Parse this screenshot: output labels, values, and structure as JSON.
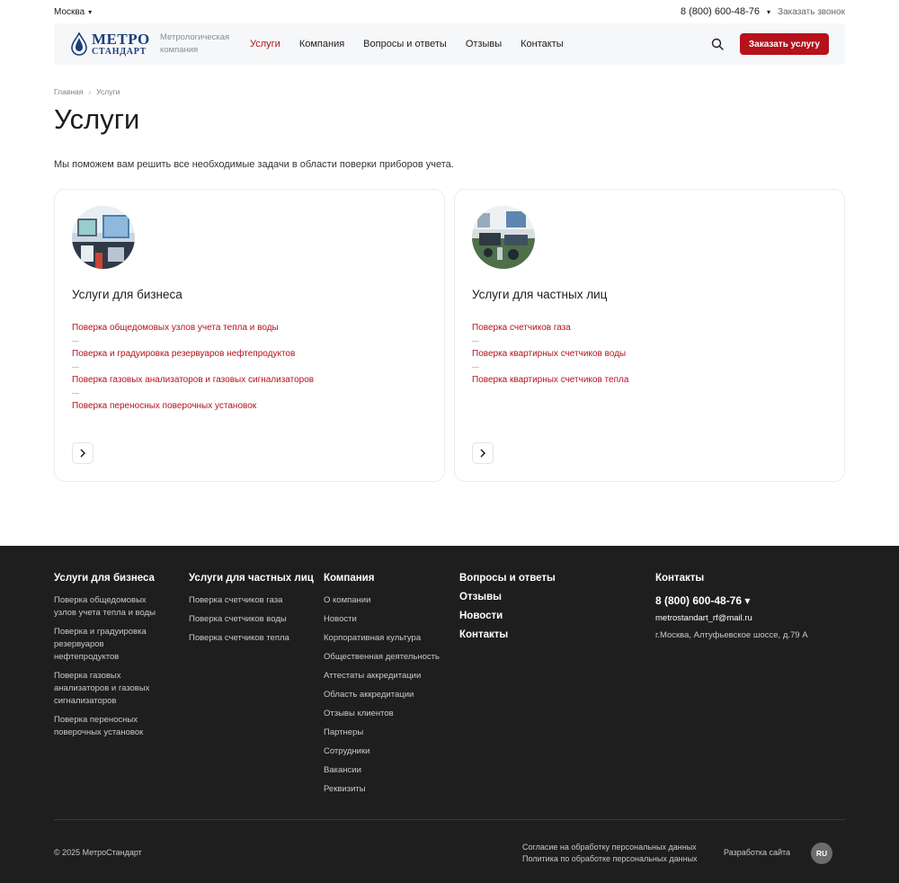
{
  "topbar": {
    "city": "Москва",
    "phone": "8 (800) 600-48-76",
    "callback": "Заказать звонок"
  },
  "header": {
    "logo_line1": "МЕТРО",
    "logo_line2": "СТАНДАРТ",
    "tagline": "Метрологическая компания",
    "nav": [
      "Услуги",
      "Компания",
      "Вопросы и ответы",
      "Отзывы",
      "Контакты"
    ],
    "active_nav": "Услуги",
    "order_label": "Заказать услугу",
    "brand_color": "#b5121b"
  },
  "breadcrumb": [
    "Главная",
    "Услуги"
  ],
  "page": {
    "title": "Услуги",
    "lead": "Мы поможем вам решить все необходимые задачи в области поверки приборов учета."
  },
  "cards": [
    {
      "title": "Услуги для бизнеса",
      "links": [
        "Поверка общедомовых узлов учета тепла и воды",
        "Поверка и градуировка резервуаров нефтепродуктов",
        "Поверка газовых анализаторов и газовых сигнализаторов",
        "Поверка переносных поверочных установок"
      ]
    },
    {
      "title": "Услуги для частных лиц",
      "links": [
        "Поверка счетчиков газа",
        "Поверка квартирных счетчиков воды",
        "Поверка квартирных счетчиков тепла"
      ]
    }
  ],
  "footer": {
    "business": {
      "title": "Услуги для бизнеса",
      "links": [
        "Поверка общедомовых узлов учета тепла и воды",
        "Поверка и градуировка резервуаров нефтепродуктов",
        "Поверка газовых анализаторов и газовых сигнализаторов",
        "Поверка переносных поверочных установок"
      ]
    },
    "private": {
      "title": "Услуги для частных лиц",
      "links": [
        "Поверка счетчиков газа",
        "Поверка счетчиков воды",
        "Поверка счетчиков тепла"
      ]
    },
    "company": {
      "title": "Компания",
      "links": [
        "О компании",
        "Новости",
        "Корпоративная культура",
        "Общественная деятельность",
        "Аттестаты аккредитации",
        "Область аккредитации",
        "Отзывы клиентов",
        "Партнеры",
        "Сотрудники",
        "Вакансии",
        "Реквизиты"
      ]
    },
    "misc": [
      "Вопросы и ответы",
      "Отзывы",
      "Новости",
      "Контакты"
    ],
    "contacts": {
      "title": "Контакты",
      "phone": "8 (800) 600-48-76",
      "email": "metrostandart_rf@mail.ru",
      "address": "г.Москва, Алтуфьевское шоссе, д.79 А"
    },
    "copyright": "© 2025 МетроСтандарт",
    "consent": "Согласие на обработку персональных данных",
    "policy": "Политика по обработке персональных данных",
    "dev": "Разработка сайта",
    "lang": "RU"
  }
}
